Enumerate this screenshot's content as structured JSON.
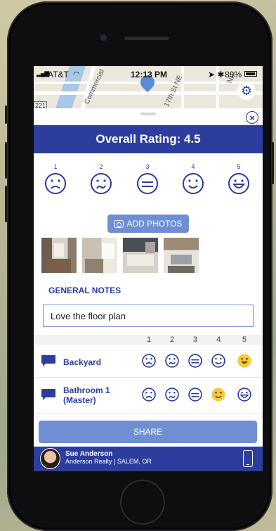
{
  "status_bar": {
    "carrier": "AT&T",
    "time": "12:13 PM",
    "battery": "89%"
  },
  "map": {
    "labels": [
      "Commercial",
      "17th St NE",
      "NE"
    ],
    "route_shield": "221"
  },
  "header": {
    "title": "Overall Rating: 4.5"
  },
  "rating_scale": {
    "numbers": [
      "1",
      "2",
      "3",
      "4",
      "5"
    ],
    "faces": [
      "sad-face-icon",
      "confused-face-icon",
      "neutral-face-icon",
      "smile-face-icon",
      "happy-face-icon"
    ]
  },
  "photos": {
    "add_label": "ADD PHOTOS",
    "thumbnail_count": 4
  },
  "notes": {
    "section_title": "GENERAL NOTES",
    "value": "Love the floor plan"
  },
  "room_ratings": {
    "column_headers": [
      "1",
      "2",
      "3",
      "4",
      "5"
    ],
    "rows": [
      {
        "label": "Backyard",
        "selected": 5
      },
      {
        "label_line1": "Bathroom 1",
        "label_line2": "(Master)",
        "selected": 4
      }
    ]
  },
  "share": {
    "label": "SHARE"
  },
  "agent": {
    "name": "Sue Anderson",
    "details": "Anderson Realty | SALEM, OR"
  },
  "colors": {
    "brand": "#2c3d9e",
    "button": "#6f8fd2",
    "selected_face": "#f4cc3a"
  }
}
